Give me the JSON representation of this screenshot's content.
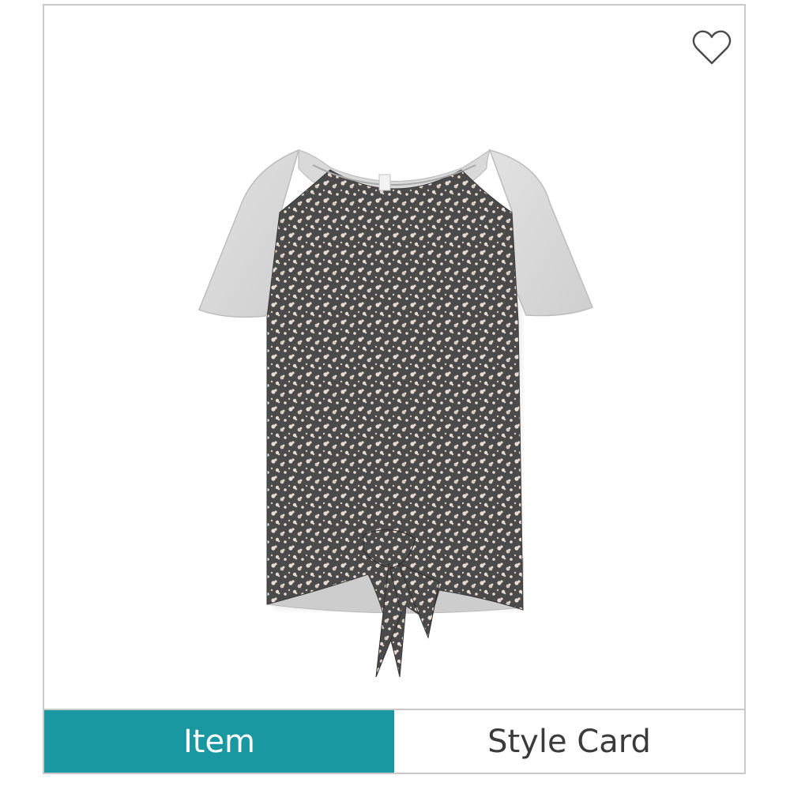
{
  "product": {
    "icon": "floral-tie-front-raglan-tee-image"
  },
  "favorite": {
    "icon": "heart-outline-icon"
  },
  "tabs": [
    {
      "label": "Item",
      "selected": true
    },
    {
      "label": "Style Card",
      "selected": false
    }
  ],
  "colors": {
    "accent": "#1a98a1",
    "border": "#c9c9c9",
    "text": "#3b3b3b"
  }
}
